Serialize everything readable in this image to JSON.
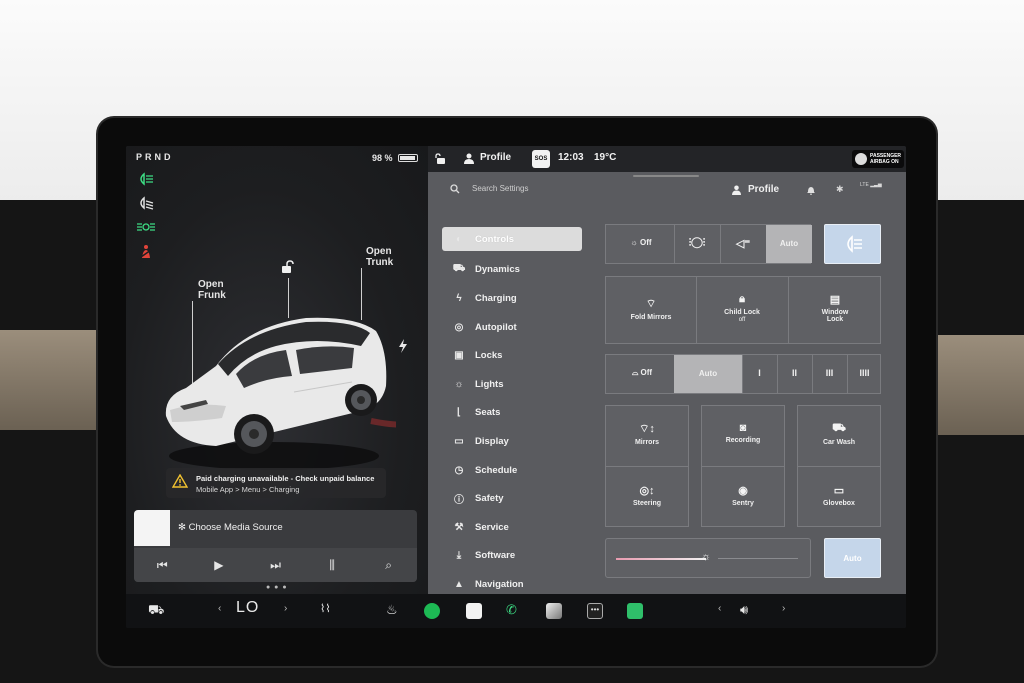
{
  "gear": "PRND",
  "battery": "98 %",
  "callouts": {
    "frunk_line1": "Open",
    "frunk_line2": "Frunk",
    "trunk_line1": "Open",
    "trunk_line2": "Trunk"
  },
  "alert": {
    "title": "Paid charging unavailable - Check unpaid balance",
    "detail": "Mobile App > Menu > Charging"
  },
  "media": {
    "source": "✻ Choose Media Source"
  },
  "topbar": {
    "profile": "Profile",
    "sos": "SOS",
    "time": "12:03",
    "temp": "19°C",
    "airbag_line1": "PASSENGER",
    "airbag_line2": "AIRBAG ON"
  },
  "settings_header": {
    "search_placeholder": "Search Settings",
    "profile": "Profile",
    "lte": "LTE"
  },
  "nav": [
    {
      "label": "Controls",
      "icon": "toggle-icon",
      "active": true
    },
    {
      "label": "Dynamics",
      "icon": "car-icon"
    },
    {
      "label": "Charging",
      "icon": "bolt-icon"
    },
    {
      "label": "Autopilot",
      "icon": "steering-wheel-icon"
    },
    {
      "label": "Locks",
      "icon": "lock-icon"
    },
    {
      "label": "Lights",
      "icon": "sun-icon"
    },
    {
      "label": "Seats",
      "icon": "seat-icon"
    },
    {
      "label": "Display",
      "icon": "display-icon"
    },
    {
      "label": "Schedule",
      "icon": "clock-icon"
    },
    {
      "label": "Safety",
      "icon": "alert-circle-icon"
    },
    {
      "label": "Service",
      "icon": "wrench-icon"
    },
    {
      "label": "Software",
      "icon": "download-icon"
    },
    {
      "label": "Navigation",
      "icon": "navigation-arrow-icon"
    }
  ],
  "lights_row": {
    "off": "Off",
    "auto": "Auto"
  },
  "mirror_row": {
    "fold_mirrors": "Fold Mirrors",
    "child_lock": "Child Lock",
    "child_lock_state": "off",
    "window_lock_line1": "Window",
    "window_lock_line2": "Lock"
  },
  "wiper_row": {
    "off": "Off",
    "auto": "Auto",
    "speeds": [
      "I",
      "II",
      "III",
      "IIII"
    ]
  },
  "tiles": {
    "mirrors": "Mirrors",
    "recording": "Recording",
    "car_wash": "Car Wash",
    "steering": "Steering",
    "sentry": "Sentry",
    "glovebox": "Glovebox"
  },
  "brightness": {
    "auto": "Auto",
    "level": 0.45
  },
  "dock": {
    "temp": "LO"
  },
  "colors": {
    "settings_bg": "#5a5b5f",
    "selected": "#b4b4b6",
    "accent_blue": "#c5d6ea",
    "tell_green": "#3ddc84",
    "tell_red": "#e0443a"
  }
}
